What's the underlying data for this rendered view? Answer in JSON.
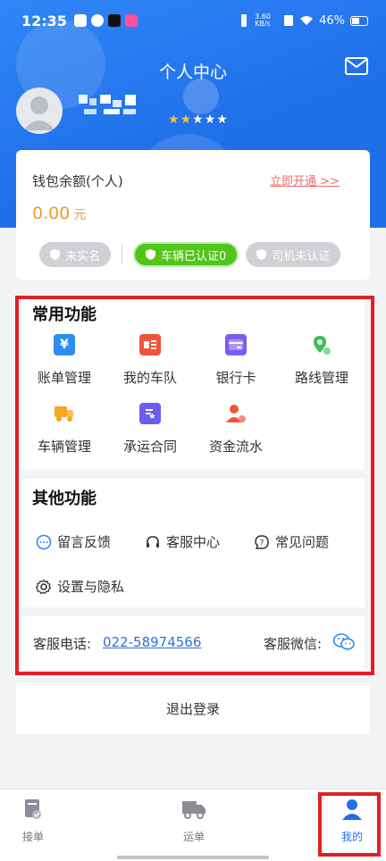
{
  "status_bar": {
    "time": "12:35",
    "net_speed": "3.60 KB/s",
    "battery": "46%"
  },
  "header": {
    "title": "个人中心"
  },
  "profile": {
    "rating_stars_filled": 2,
    "rating_stars_total": 5
  },
  "wallet": {
    "label": "钱包余额(个人)",
    "open_link": "立即开通 >>",
    "amount": "0.00",
    "currency": "元",
    "badges": [
      {
        "label": "未实名",
        "state": "inactive"
      },
      {
        "label": "车辆已认证0",
        "state": "active"
      },
      {
        "label": "司机未认证",
        "state": "inactive"
      }
    ]
  },
  "common_functions": {
    "title": "常用功能",
    "items": [
      {
        "label": "账单管理",
        "icon": "bill-icon",
        "color": "#2d8cf0"
      },
      {
        "label": "我的车队",
        "icon": "fleet-icon",
        "color": "#f0543c"
      },
      {
        "label": "银行卡",
        "icon": "bank-card-icon",
        "color": "#7b5cf0"
      },
      {
        "label": "路线管理",
        "icon": "route-icon",
        "color": "#3cbf5a"
      },
      {
        "label": "车辆管理",
        "icon": "truck-icon",
        "color": "#f5a623"
      },
      {
        "label": "承运合同",
        "icon": "contract-icon",
        "color": "#6a5cf0"
      },
      {
        "label": "资金流水",
        "icon": "cash-flow-icon",
        "color": "#f0543c"
      }
    ]
  },
  "other_functions": {
    "title": "其他功能",
    "items": [
      {
        "label": "留言反馈",
        "icon": "feedback-icon"
      },
      {
        "label": "客服中心",
        "icon": "headset-icon"
      },
      {
        "label": "常见问题",
        "icon": "faq-icon"
      },
      {
        "label": "设置与隐私",
        "icon": "settings-icon"
      }
    ]
  },
  "customer_service": {
    "phone_label": "客服电话:",
    "phone": "022-58974566",
    "wechat_label": "客服微信:"
  },
  "logout": {
    "label": "退出登录"
  },
  "tabbar": {
    "tabs": [
      {
        "label": "接单",
        "active": false
      },
      {
        "label": "运单",
        "active": false
      },
      {
        "label": "我的",
        "active": true
      }
    ]
  },
  "colors": {
    "primary": "#1f6fe8",
    "highlight": "#e31f26",
    "amount": "#f09b2d",
    "link": "#f06a6a"
  }
}
